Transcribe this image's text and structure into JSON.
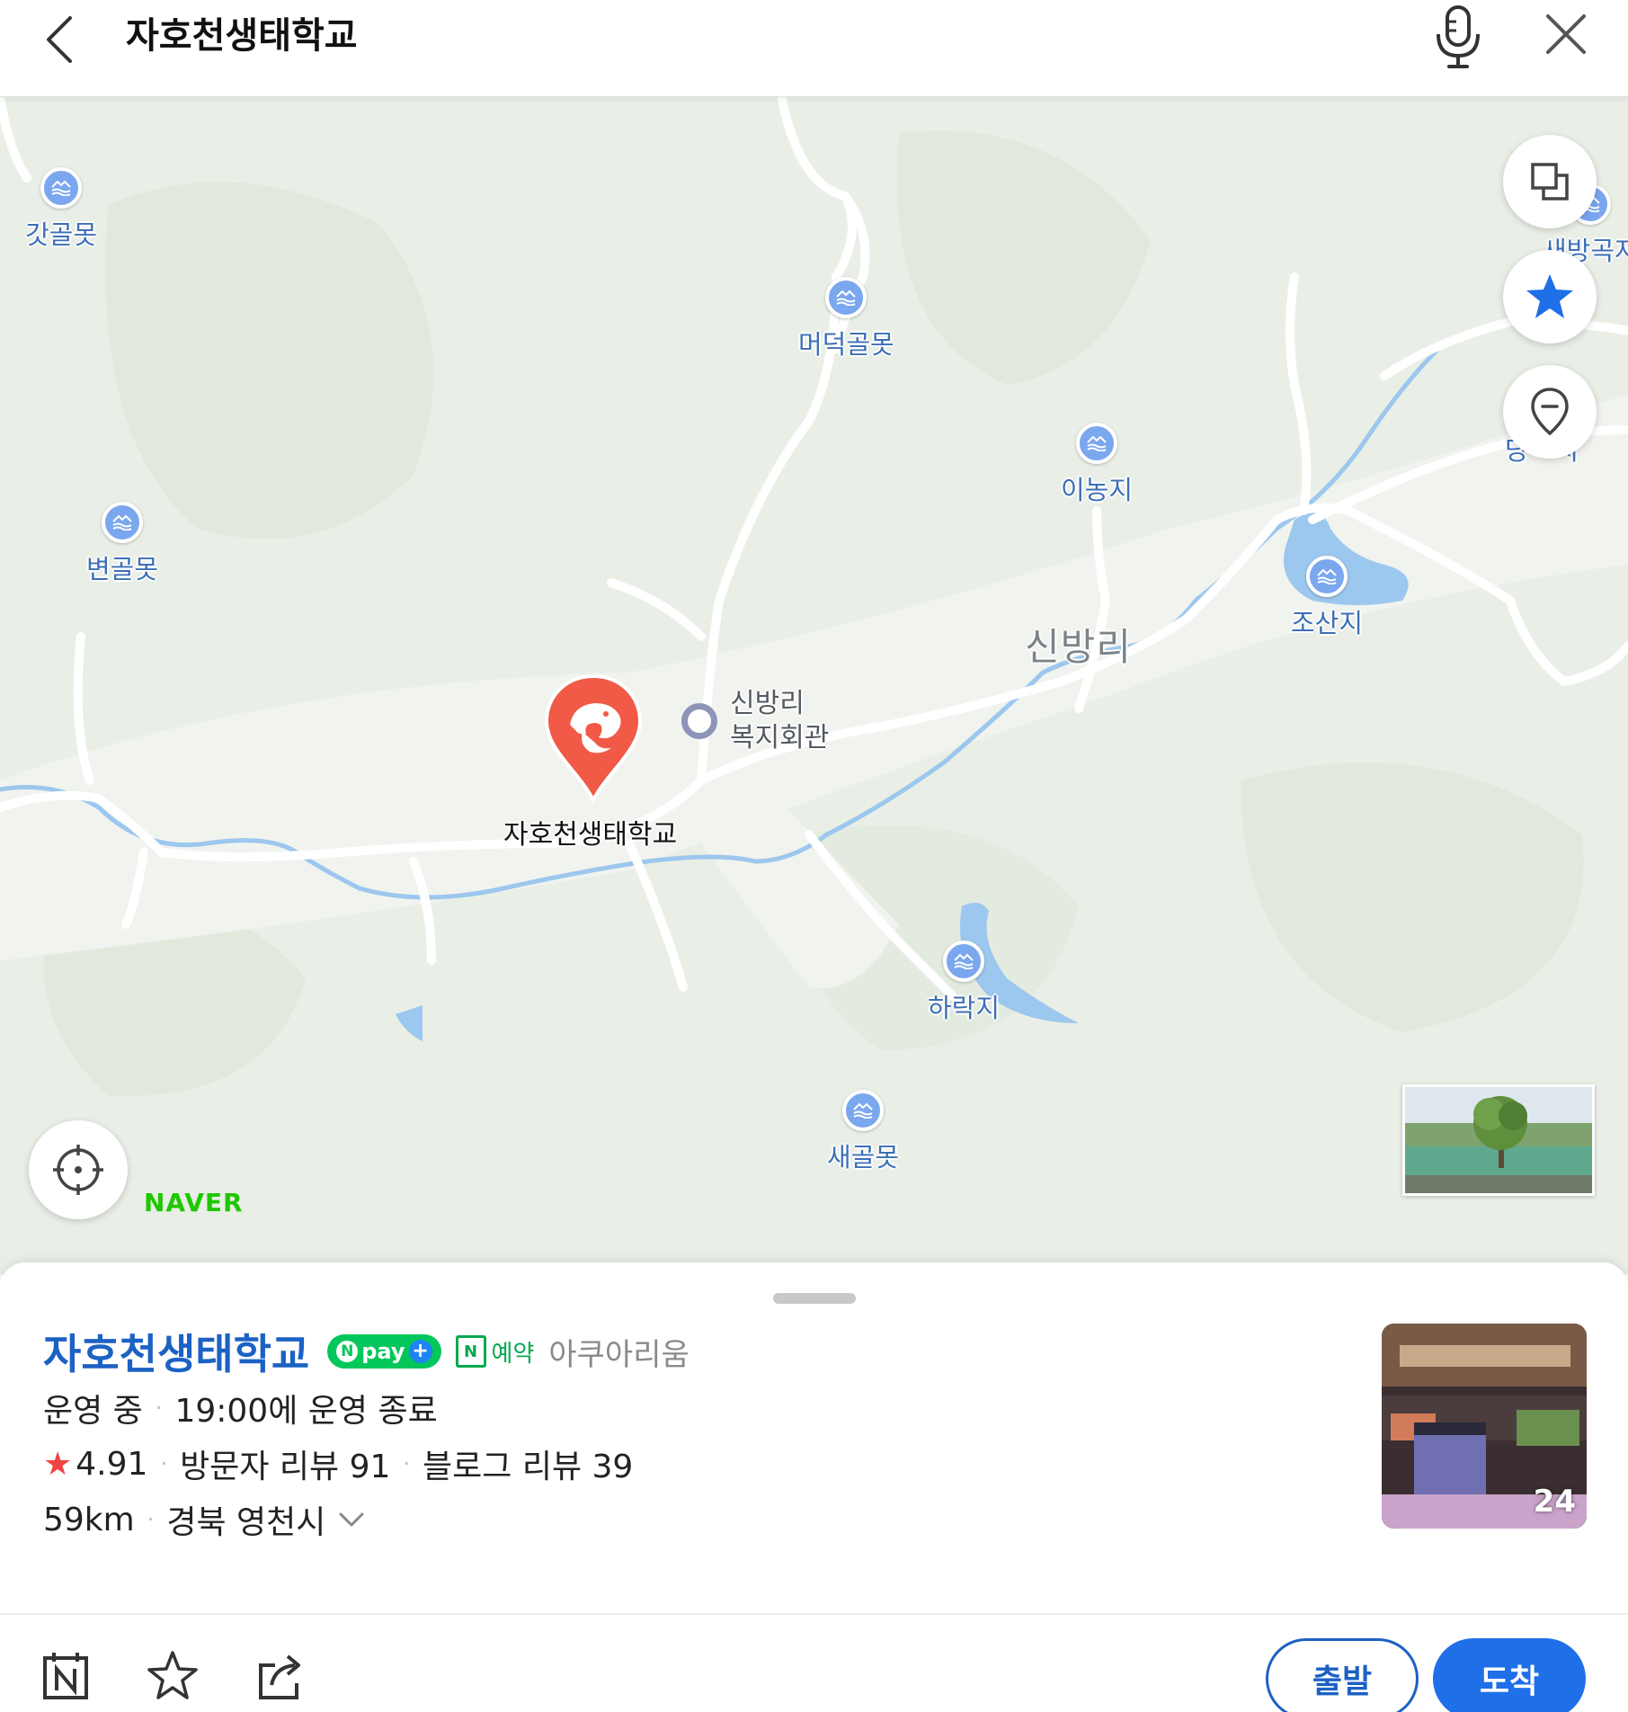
{
  "search": {
    "query": "자호천생태학교"
  },
  "map": {
    "water_pois": [
      {
        "label": "갓골못",
        "icon": "water-icon"
      },
      {
        "label": "머덕골못",
        "icon": "water-icon"
      },
      {
        "label": "새방곡저",
        "icon": "water-icon"
      },
      {
        "label": "이농지",
        "icon": "water-icon"
      },
      {
        "label": "변골못",
        "icon": "water-icon"
      },
      {
        "label": "조산지",
        "icon": "water-icon"
      },
      {
        "label": "하락지",
        "icon": "water-icon"
      },
      {
        "label": "새골못",
        "icon": "water-icon"
      }
    ],
    "village_label": "신방리",
    "building_label_line1": "신방리",
    "building_label_line2": "복지회관",
    "selected_place_label": "자호천생태학교",
    "brand_logo": "NAVER",
    "cut_off_label": "당ㅁ지"
  },
  "sheet": {
    "name": "자호천생태학교",
    "npay_text": "pay",
    "reserve_text": "예약",
    "category": "아쿠아리움",
    "status": "운영 중",
    "hours": "19:00에 운영 종료",
    "rating": "4.91",
    "visitor_reviews": "방문자 리뷰 91",
    "blog_reviews": "블로그 리뷰 39",
    "distance": "59km",
    "region": "경북 영천시",
    "photo_count": "24",
    "depart_label": "출발",
    "arrive_label": "도착"
  },
  "colors": {
    "brand_blue": "#1c61c4",
    "naver_green": "#03c75a",
    "pin_red": "#f05a46",
    "water_blue": "#8fc1ee"
  }
}
